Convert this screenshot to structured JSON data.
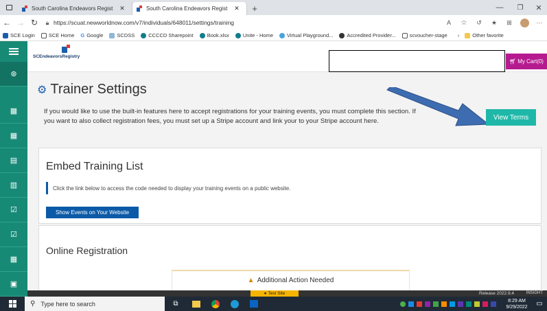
{
  "browser": {
    "tabs": [
      {
        "label": "South Carolina Endeavors Regist"
      },
      {
        "label": "South Carolina Endeavors Regist"
      }
    ],
    "new_tab": "+",
    "url": "https://scuat.newworldnow.com/v7/individuals/648011/settings/training",
    "bookmarks": [
      "SCE Login",
      "SCE Home",
      "Google",
      "SCDSS",
      "CCCCD Sharepoint",
      "Book.xlsx",
      "Unite - Home",
      "Virtual Playground...",
      "Accredited Provider...",
      "scvoucher-stage"
    ],
    "other_favorites": "Other favorite"
  },
  "app": {
    "logo_name": "SCEndeavorsRegistry",
    "cart_label": "My Cart(0)",
    "page_title": "Trainer Settings",
    "intro_text": "If you would like to use the built-in features here to accept registrations for your training events, you must complete this section. If you want to also collect registration fees, you must set up a Stripe account and link your to your Stripe account here.",
    "view_terms": "View Terms",
    "embed": {
      "title": "Embed Training List",
      "help": "Click the link below to access the code needed to display your training events on a public website.",
      "button": "Show Events on Your Website"
    },
    "online": {
      "title": "Online Registration",
      "alert": "Additional Action Needed"
    },
    "footer": {
      "test_site": "Test Site",
      "release": "Release 2022.9.4",
      "insight": "INSIGHT"
    }
  },
  "taskbar": {
    "search_placeholder": "Type here to search",
    "time": "8:29 AM",
    "date": "9/29/2022"
  },
  "colors": {
    "teal": "#178a76",
    "button_teal": "#1fb8a8",
    "blue": "#0b5aa8",
    "cart": "#b51b8f",
    "arrow": "#3d6cb0"
  }
}
